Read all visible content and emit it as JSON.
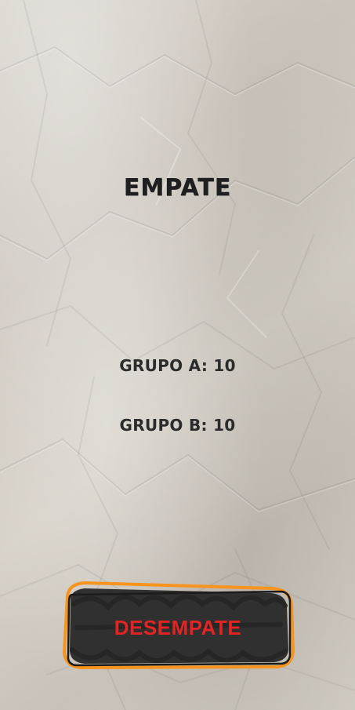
{
  "result": {
    "title": "EMPATE"
  },
  "scores": [
    {
      "label": "GRUPO A: 10",
      "group": "GRUPO A",
      "points": 10
    },
    {
      "label": "GRUPO B: 10",
      "group": "GRUPO B",
      "points": 10
    }
  ],
  "actions": {
    "tiebreak_label": "DESEMPATE"
  },
  "colors": {
    "paper": "#d3cec5",
    "text": "#222222",
    "button_fill": "#303030",
    "button_outline": "#f7941d",
    "button_text": "#e32424"
  }
}
